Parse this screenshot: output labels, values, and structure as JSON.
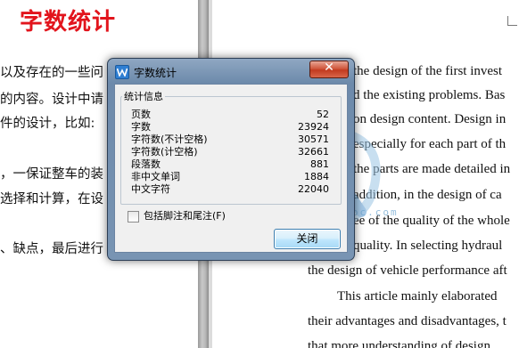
{
  "left_page": {
    "title": "字数统计",
    "lines": [
      "以及存在的一些问",
      "的内容。设计中请",
      "件的设计，比如:",
      "，一保证整车的装",
      "选择和计算，在设",
      "、缺点，最后进行"
    ]
  },
  "right_page": {
    "lines": [
      "the design of the first invest",
      "d the existing problems. Bas",
      "on design content. Design in",
      "especially for each part of th",
      "the parts are made detailed in",
      "addition, in the design of ca",
      "ee of the quality of the whole",
      "quality. In selecting hydraul",
      "the design of vehicle performance aft",
      "This article mainly elaborated",
      "their advantages and disadvantages, t",
      "that more understanding of design"
    ]
  },
  "watermark": {
    "text": "www.renrendoc.com"
  },
  "dialog": {
    "title": "字数统计",
    "close_glyph": "✕",
    "group_label": "统计信息",
    "stats": [
      {
        "label": "页数",
        "value": "52"
      },
      {
        "label": "字数",
        "value": "23924"
      },
      {
        "label": "字符数(不计空格)",
        "value": "30571"
      },
      {
        "label": "字符数(计空格)",
        "value": "32661"
      },
      {
        "label": "段落数",
        "value": "881"
      },
      {
        "label": "非中文单词",
        "value": "1884"
      },
      {
        "label": "中文字符",
        "value": "22040"
      }
    ],
    "include_notes_label": "包括脚注和尾注(F)",
    "include_notes_checked": false,
    "ok_button": "关闭"
  },
  "colors": {
    "title_red": "#e2141c",
    "dialog_frame": "#7894b3",
    "close_button": "#c23a1f",
    "watermark": "#6aa4cf"
  }
}
